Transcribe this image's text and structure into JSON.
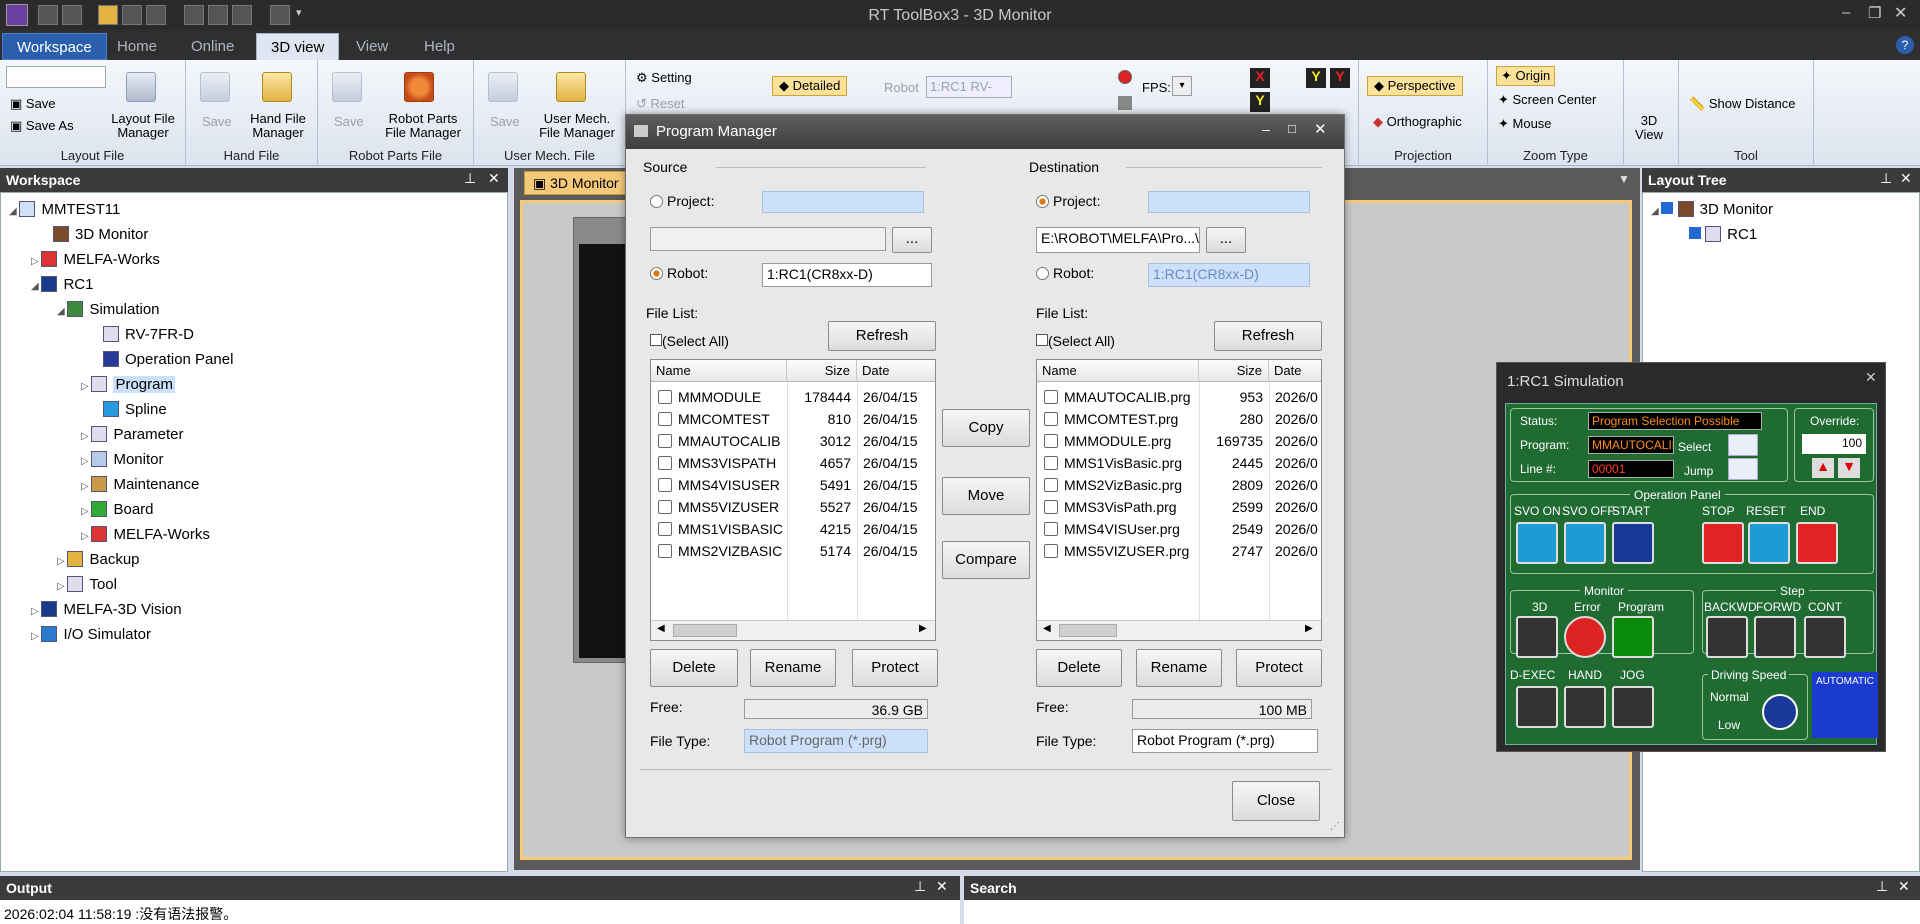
{
  "app": {
    "title": "RT ToolBox3 - 3D Monitor"
  },
  "tabs": [
    "Workspace",
    "Home",
    "Online",
    "3D view",
    "View",
    "Help"
  ],
  "ribbon": {
    "save": "Save",
    "save_as": "Save As",
    "layout_file_manager": "Layout File\nManager",
    "layout_group": "Layout File",
    "hand_save": "Save",
    "hand_manager": "Hand File\nManager",
    "hand_group": "Hand File",
    "parts_save": "Save",
    "parts_manager": "Robot Parts\nFile Manager",
    "parts_group": "Robot Parts File",
    "mech_save": "Save",
    "mech_manager": "User Mech.\nFile Manager",
    "mech_group": "User Mech. File",
    "setting": "Setting",
    "reset": "Reset",
    "detailed": "Detailed",
    "robot_label": "Robot",
    "robot_value": "1:RC1 RV-",
    "fps": "FPS:",
    "perspective": "Perspective",
    "orthographic": "Orthographic",
    "projection_group": "Projection",
    "origin": "Origin",
    "screen_center": "Screen Center",
    "mouse": "Mouse",
    "zoom_group": "Zoom Type",
    "view3d": "3D\nView",
    "show_distance": "Show Distance",
    "tool_group": "Tool"
  },
  "workspace": {
    "title": "Workspace",
    "items": [
      "MMTEST11",
      "3D Monitor",
      "MELFA-Works",
      "RC1",
      "Simulation",
      "RV-7FR-D",
      "Operation Panel",
      "Program",
      "Spline",
      "Parameter",
      "Monitor",
      "Maintenance",
      "Board",
      "MELFA-Works",
      "Backup",
      "Tool",
      "MELFA-3D Vision",
      "I/O Simulator"
    ]
  },
  "doc_tab": "3D Monitor",
  "layout_tree": {
    "title": "Layout Tree",
    "items": [
      "3D Monitor",
      "RC1"
    ]
  },
  "dialog": {
    "title": "Program Manager",
    "source": {
      "label": "Source",
      "project": "Project:",
      "robot": "Robot:",
      "robot_value": "1:RC1(CR8xx-D)",
      "file_list": "File List:",
      "select_all": "(Select All)",
      "refresh": "Refresh",
      "col_name": "Name",
      "col_size": "Size",
      "col_date": "Date",
      "rows": [
        {
          "name": "MMMODULE",
          "size": "178444",
          "date": "26/04/15"
        },
        {
          "name": "MMCOMTEST",
          "size": "810",
          "date": "26/04/15"
        },
        {
          "name": "MMAUTOCALIB",
          "size": "3012",
          "date": "26/04/15"
        },
        {
          "name": "MMS3VISPATH",
          "size": "4657",
          "date": "26/04/15"
        },
        {
          "name": "MMS4VISUSER",
          "size": "5491",
          "date": "26/04/15"
        },
        {
          "name": "MMS5VIZUSER",
          "size": "5527",
          "date": "26/04/15"
        },
        {
          "name": "MMS1VISBASIC",
          "size": "4215",
          "date": "26/04/15"
        },
        {
          "name": "MMS2VIZBASIC",
          "size": "5174",
          "date": "26/04/15"
        }
      ],
      "delete": "Delete",
      "rename": "Rename",
      "protect": "Protect",
      "free_label": "Free:",
      "free_value": "36.9 GB",
      "file_type_label": "File Type:",
      "file_type_value": "Robot Program (*.prg)"
    },
    "dest": {
      "label": "Destination",
      "project": "Project:",
      "path": "E:\\ROBOT\\MELFA\\Pro...\\Program",
      "robot": "Robot:",
      "robot_value": "1:RC1(CR8xx-D)",
      "file_list": "File List:",
      "select_all": "(Select All)",
      "refresh": "Refresh",
      "col_name": "Name",
      "col_size": "Size",
      "col_date": "Date",
      "rows": [
        {
          "name": "MMAUTOCALIB.prg",
          "size": "953",
          "date": "2026/0"
        },
        {
          "name": "MMCOMTEST.prg",
          "size": "280",
          "date": "2026/0"
        },
        {
          "name": "MMMODULE.prg",
          "size": "169735",
          "date": "2026/0"
        },
        {
          "name": "MMS1VisBasic.prg",
          "size": "2445",
          "date": "2026/0"
        },
        {
          "name": "MMS2VizBasic.prg",
          "size": "2809",
          "date": "2026/0"
        },
        {
          "name": "MMS3VisPath.prg",
          "size": "2599",
          "date": "2026/0"
        },
        {
          "name": "MMS4VISUser.prg",
          "size": "2549",
          "date": "2026/0"
        },
        {
          "name": "MMS5VIZUSER.prg",
          "size": "2747",
          "date": "2026/0"
        }
      ],
      "delete": "Delete",
      "rename": "Rename",
      "protect": "Protect",
      "free_label": "Free:",
      "free_value": "100 MB",
      "file_type_label": "File Type:",
      "file_type_value": "Robot Program (*.prg)"
    },
    "copy": "Copy",
    "move": "Move",
    "compare": "Compare",
    "close": "Close",
    "browse": "..."
  },
  "simulation": {
    "title": "1:RC1  Simulation",
    "status_label": "Status:",
    "status_value": "Program Selection Possible",
    "program_label": "Program:",
    "program_value": "MMAUTOCALIB",
    "select": "Select",
    "line_label": "Line #:",
    "line_value": "00001",
    "jump": "Jump",
    "override_label": "Override:",
    "override_value": "100",
    "op_panel": "Operation Panel",
    "svo_on": "SVO ON",
    "svo_off": "SVO OFF",
    "start": "START",
    "stop": "STOP",
    "reset": "RESET",
    "end": "END",
    "monitor": "Monitor",
    "m3d": "3D",
    "error": "Error",
    "program": "Program",
    "step": "Step",
    "backwd": "BACKWD",
    "forwd": "FORWD",
    "cont": "CONT",
    "dexec": "D-EXEC",
    "hand": "HAND",
    "jog": "JOG",
    "driving_speed": "Driving Speed",
    "normal": "Normal",
    "low": "Low",
    "automatic": "AUTOMATIC"
  },
  "output": {
    "title": "Output",
    "line": "2026:02:04 11:58:19 :没有语法报警。"
  },
  "search": {
    "title": "Search"
  }
}
